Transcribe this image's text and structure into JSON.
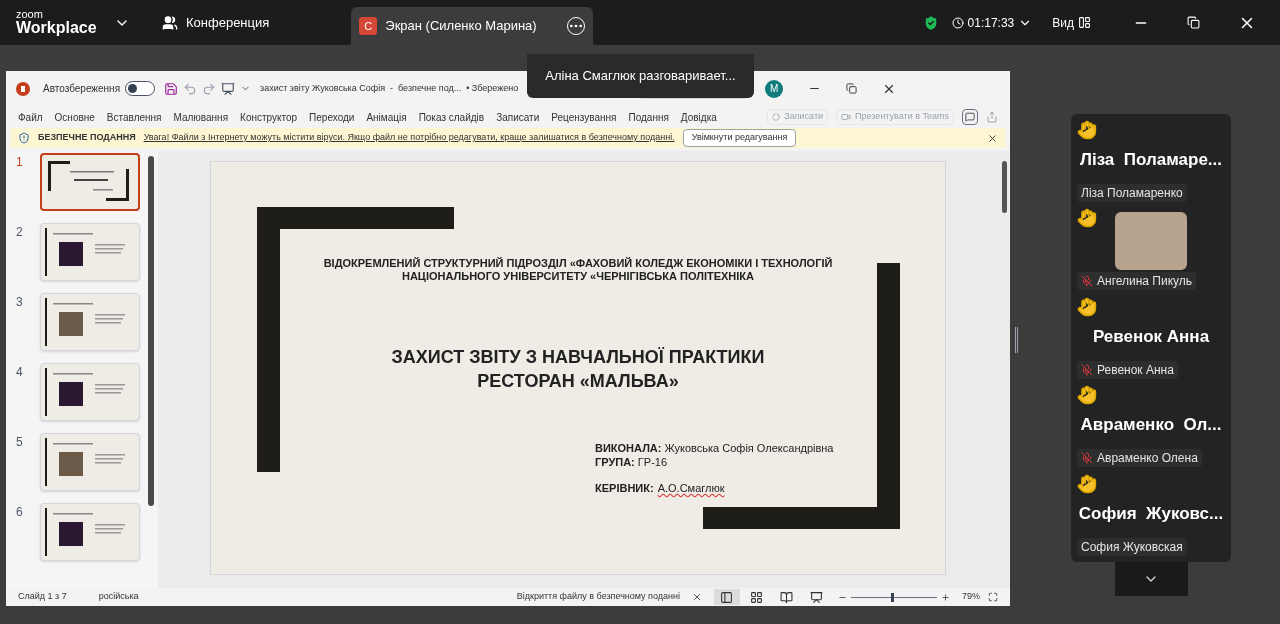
{
  "zoom_bar": {
    "logo_top": "zoom",
    "logo_bottom": "Workplace",
    "meeting_label": "Конференция",
    "share_tab": {
      "badge": "С",
      "label": "Экран (Силенко Марина)"
    },
    "timer": "01:17:33",
    "view_label": "Вид"
  },
  "speaking_toast": "Аліна Смаглюк разговаривает...",
  "ppt": {
    "autosave_label": "Автозбереження",
    "autosave_on": false,
    "doc_title": "захист звіту Жуковська Софія  -  безпечне под...",
    "save_state": "• Збережено",
    "avatar": "M",
    "menu": [
      "Файл",
      "Основне",
      "Вставлення",
      "Малювання",
      "Конструктор",
      "Переходи",
      "Анімація",
      "Показ слайдів",
      "Записати",
      "Рецензування",
      "Подання",
      "Довідка"
    ],
    "record_button": "Записати",
    "present_button": "Презентувати в Teams",
    "protected_bar": {
      "label": "БЕЗПЕЧНЕ ПОДАННЯ",
      "message": "Увага! Файли з Інтернету можуть містити віруси. Якщо файл не потрібно редагувати, краще залишатися в безпечному поданні.",
      "button": "Увімкнути редагування"
    },
    "thumbnails": [
      {
        "number": "1",
        "selected": true,
        "kind": "title"
      },
      {
        "number": "2",
        "selected": false,
        "kind": "content"
      },
      {
        "number": "3",
        "selected": false,
        "kind": "content"
      },
      {
        "number": "4",
        "selected": false,
        "kind": "content"
      },
      {
        "number": "5",
        "selected": false,
        "kind": "content"
      },
      {
        "number": "6",
        "selected": false,
        "kind": "content"
      }
    ],
    "slide": {
      "org_lines": [
        "ВІДОКРЕМЛЕНИЙ СТРУКТУРНИЙ ПІДРОЗДІЛ «ФАХОВИЙ КОЛЕДЖ ЕКОНОМІКИ І ТЕХНОЛОГІЙ",
        "НАЦІОНАЛЬНОГО УНІВЕРСИТЕТУ «ЧЕРНІГІВСЬКА ПОЛІТЕХНІКА"
      ],
      "title_lines": [
        "ЗАХИСТ ЗВІТУ З НАВЧАЛЬНОЇ ПРАКТИКИ",
        "РЕСТОРАН «МАЛЬВА»"
      ],
      "credits": [
        "**ВИКОНАЛА:** Жуковська Софія Олександрівна",
        "**ГРУПА:** ГР-16"
      ],
      "supervisor_label": "КЕРІВНИК:",
      "supervisor": "А.О.Смаглюк"
    },
    "status": {
      "slide_count": "Слайд 1 з 7",
      "language": "російська",
      "notice": "Відкриття файлу в безпечному поданні",
      "views": [
        {
          "kind": "normal",
          "selected": true
        },
        {
          "kind": "sorter",
          "selected": false
        },
        {
          "kind": "reading",
          "selected": false
        },
        {
          "kind": "slideshow",
          "selected": false
        }
      ],
      "zoom": {
        "level": 0.47,
        "reading": "79%"
      }
    }
  },
  "participants": [
    {
      "kind": "name",
      "display": "Ліза  Поламаре...",
      "label": "Ліза Поламаренко",
      "muted": false
    },
    {
      "kind": "photo",
      "label": "Ангелина Пикуль",
      "muted": true
    },
    {
      "kind": "name",
      "display": "Ревенок Анна",
      "label": "Ревенок Анна",
      "muted": true
    },
    {
      "kind": "name",
      "display": "Авраменко  Ол...",
      "label": "Авраменко Олена",
      "muted": true
    },
    {
      "kind": "name",
      "display": "София  Жуковс...",
      "label": "София Жуковская",
      "muted": false
    }
  ]
}
